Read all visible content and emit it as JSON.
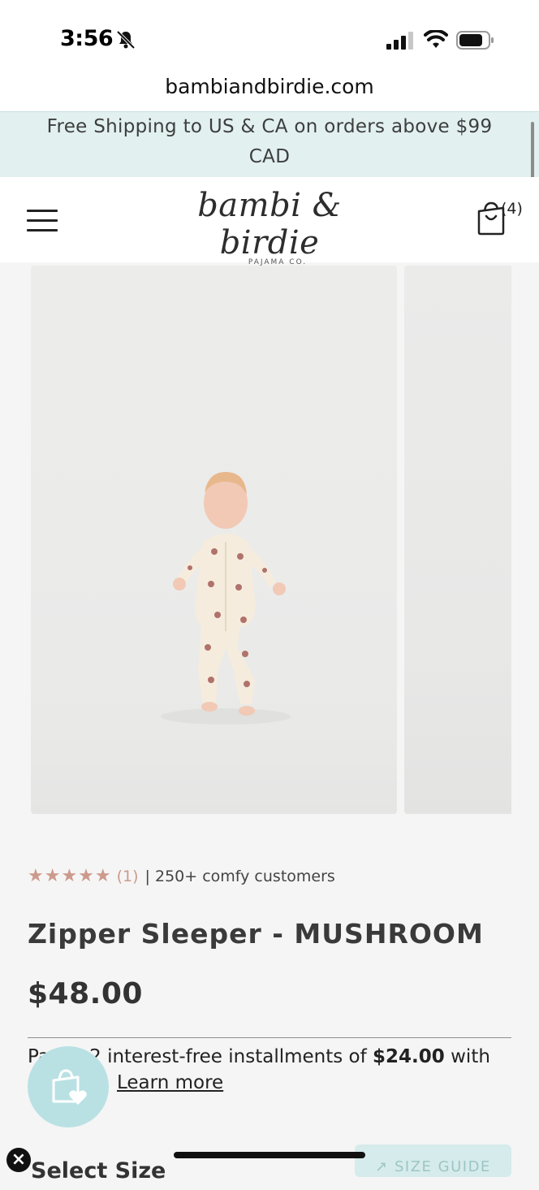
{
  "status_bar": {
    "time": "3:56"
  },
  "browser": {
    "url": "bambiandbirdie.com"
  },
  "announcement": {
    "text": "Free Shipping to US & CA on orders above $99 CAD"
  },
  "header": {
    "logo_main": "bambi & birdie",
    "logo_sub": "PAJAMA CO.",
    "cart_count": "(4)"
  },
  "product": {
    "rating_stars": "★★★★★",
    "review_count": "(1)",
    "customers_text": "| 250+ comfy customers",
    "title": "Zipper Sleeper - MUSHROOM",
    "price": "$48.00",
    "installments_prefix": "Pay in 2 interest-free installments of",
    "installment_amount": "$24.00",
    "installments_suffix": "with",
    "learn_more": "Learn more",
    "select_size": "Select Size",
    "size_guide": "↗ SIZE GUIDE"
  },
  "colors": {
    "announcement_bg": "#e2f0f0",
    "star_color": "#cc9a8c",
    "wishlist_bg": "#b9e1e4"
  },
  "icons": [
    "bell-slash-icon",
    "signal-icon",
    "wifi-icon",
    "battery-icon",
    "hamburger-menu-icon",
    "shopping-bag-icon",
    "wishlist-bag-heart-icon",
    "close-icon"
  ]
}
